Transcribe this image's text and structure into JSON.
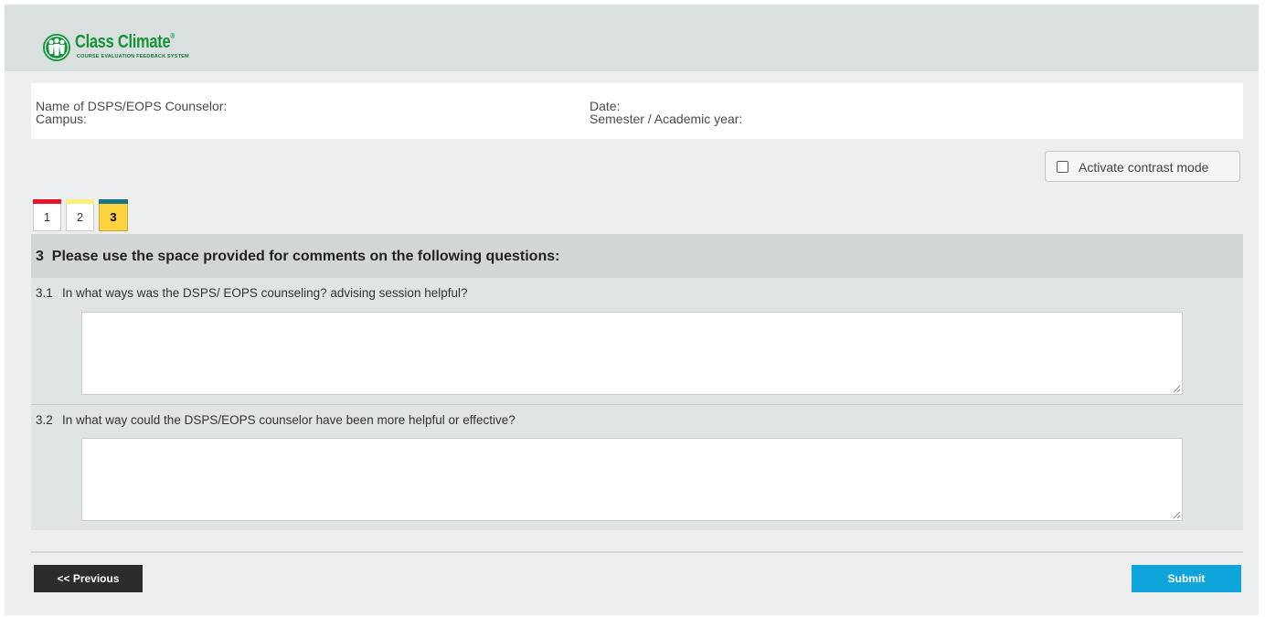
{
  "header": {
    "logo": {
      "name": "Class Climate",
      "registered": "®",
      "tagline": "COURSE EVALUATION FEEDBACK SYSTEM",
      "color": "#129437"
    }
  },
  "info": {
    "counselor_label": "Name of DSPS/EOPS Counselor:",
    "campus_label": "Campus:",
    "date_label": "Date:",
    "semester_label": "Semester / Academic year:"
  },
  "contrast": {
    "label": "Activate contrast mode",
    "checked": false
  },
  "tabs": [
    {
      "label": "1",
      "color": "#e8142a",
      "active": false
    },
    {
      "label": "2",
      "color": "#f8f27a",
      "active": false
    },
    {
      "label": "3",
      "color": "#177489",
      "active": true
    }
  ],
  "section": {
    "number": "3",
    "title": "Please use the space provided for comments on the following questions:",
    "heading": "3  Please use the space provided for comments on the following questions:"
  },
  "questions": [
    {
      "number": "3.1",
      "text": "In what ways was the DSPS/ EOPS counseling? advising session helpful?",
      "value": ""
    },
    {
      "number": "3.2",
      "text": "In what way could the DSPS/EOPS counselor have been more helpful or effective?",
      "value": ""
    }
  ],
  "footer": {
    "previous_label": "<< Previous",
    "submit_label": "Submit"
  },
  "colors": {
    "submit": "#10a5da",
    "previous": "#2c2c2c",
    "active_tab": "#fbd240"
  }
}
